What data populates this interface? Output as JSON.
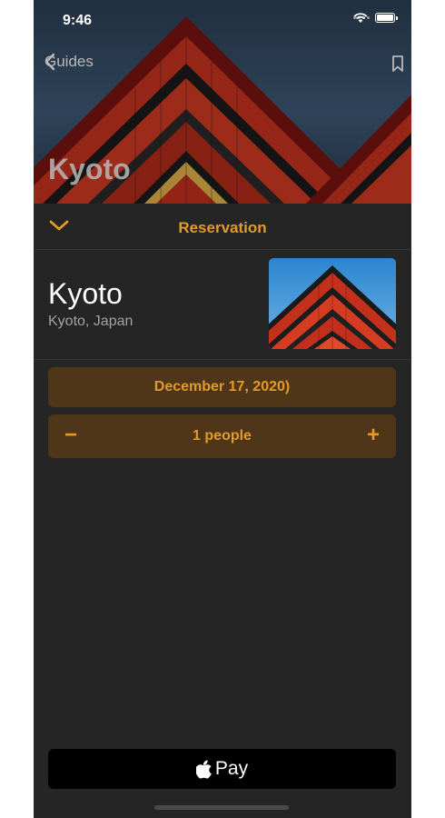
{
  "status_bar": {
    "time": "9:46"
  },
  "nav": {
    "back_label": "Guides",
    "hero_title": "Kyoto"
  },
  "sheet": {
    "title": "Reservation",
    "place_name": "Kyoto",
    "place_location": "Kyoto, Japan",
    "date_label": "December 17, 2020)",
    "people_label": "1 people",
    "minus_label": "−",
    "plus_label": "+",
    "pay_label": "Pay"
  },
  "colors": {
    "accent": "#e39a2b",
    "accent_bg": "#4f3618",
    "sheet_bg": "#252525",
    "pay_bg": "#000000"
  },
  "icons": {
    "back": "chevron-left-icon",
    "bookmark": "bookmark-icon",
    "collapse": "chevron-down-icon",
    "wifi": "wifi-icon",
    "battery": "battery-icon",
    "apple": "apple-logo-icon"
  }
}
